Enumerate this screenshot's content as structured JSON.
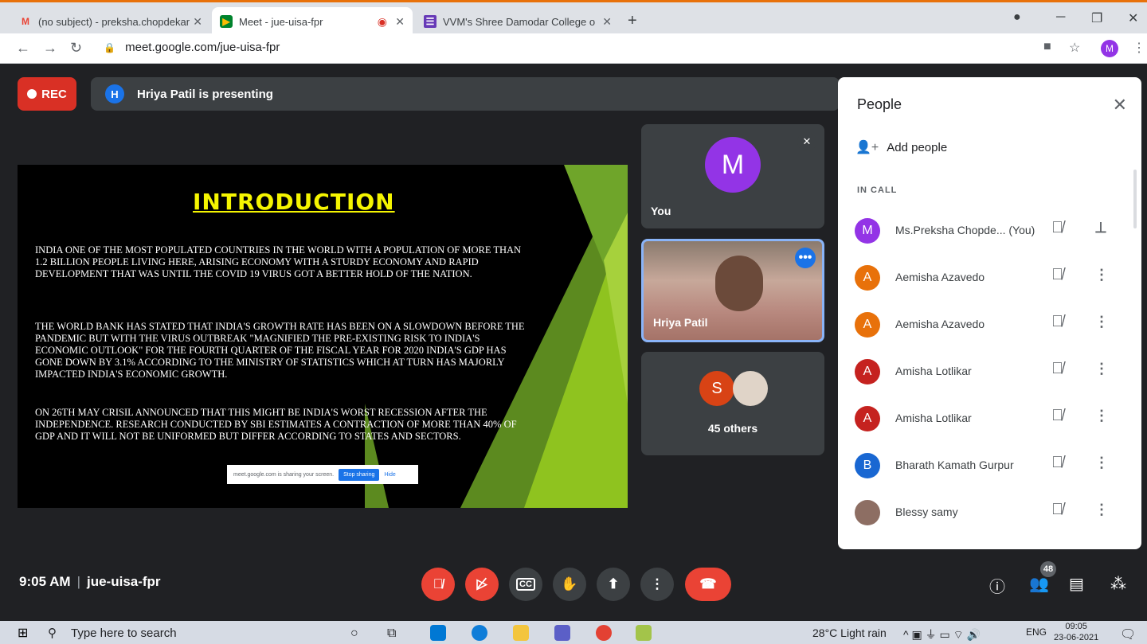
{
  "browser": {
    "tabs": [
      {
        "title": "(no subject) - preksha.chopdekar",
        "icon": "gmail-icon",
        "active": false
      },
      {
        "title": "Meet - jue-uisa-fpr",
        "icon": "meet-icon",
        "active": true
      },
      {
        "title": "VVM's Shree Damodar College o",
        "icon": "forms-icon",
        "active": false
      }
    ],
    "new_tab": "+",
    "url": "meet.google.com/jue-uisa-fpr",
    "profile_initial": "M"
  },
  "meet": {
    "rec_label": "REC",
    "presenter_initial": "H",
    "presenting_text": "Hriya Patil is presenting",
    "slide": {
      "title": "INTRODUCTION",
      "para1": "India one of the most populated countries in the world with a population of more than 1.2 billion people living here, arising economy with a sturdy economy and rapid development that was until the covid 19 virus got a better hold of the nation.",
      "para2": "The World Bank has stated that India's growth rate has been on a slowdown before the pandemic but with the virus outbreak \"magnified the pre-existing risk to India's economic outlook\" for the fourth quarter of the fiscal year for 2020 India's GDP has gone down by 3.1% according to the ministry of statistics which at turn has majorly impacted India's economic growth.",
      "para3": "On 26th May CRISIL announced that this might be India's worst recession after the independence. Research conducted by SBI estimates a contraction of more than 40% of GDP and it will not be uniformed but differ according to states and sectors.",
      "share_notice": "meet.google.com is sharing your screen.",
      "stop_sharing": "Stop sharing",
      "hide": "Hide"
    },
    "tiles": {
      "you_initial": "M",
      "you_label": "You",
      "hriya_label": "Hriya Patil",
      "others_initial": "S",
      "others_label": "45 others"
    },
    "meeting_time": "9:05 AM",
    "meeting_code": "jue-uisa-fpr",
    "participant_count": "48"
  },
  "people_panel": {
    "title": "People",
    "add_people": "Add people",
    "section": "IN CALL",
    "participants": [
      {
        "name": "Ms.Preksha Chopde... (You)",
        "initial": "M",
        "color": "#9334e6"
      },
      {
        "name": "Aemisha Azavedo",
        "initial": "A",
        "color": "#e8710a"
      },
      {
        "name": "Aemisha Azavedo",
        "initial": "A",
        "color": "#e8710a"
      },
      {
        "name": "Amisha Lotlikar",
        "initial": "A",
        "color": "#c5221f"
      },
      {
        "name": "Amisha Lotlikar",
        "initial": "A",
        "color": "#c5221f"
      },
      {
        "name": "Bharath Kamath Gurpur",
        "initial": "B",
        "color": "#1967d2"
      },
      {
        "name": "Blessy samy",
        "initial": "",
        "color": "#8d6e63"
      }
    ]
  },
  "taskbar": {
    "search_placeholder": "Type here to search",
    "weather": "28°C  Light rain",
    "lang": "ENG",
    "time": "09:05",
    "date": "23-06-2021"
  }
}
